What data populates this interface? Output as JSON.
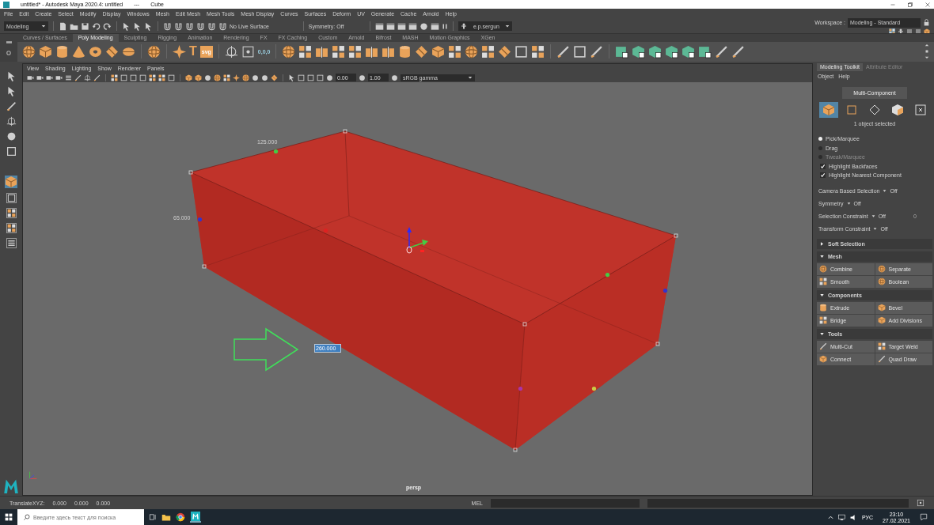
{
  "window": {
    "title": "untitled* - Autodesk Maya 2020.4: untitled",
    "separator": "---",
    "object": "Cube"
  },
  "menu_bar": [
    "File",
    "Edit",
    "Create",
    "Select",
    "Modify",
    "Display",
    "Windows",
    "Mesh",
    "Edit Mesh",
    "Mesh Tools",
    "Mesh Display",
    "Curves",
    "Surfaces",
    "Deform",
    "UV",
    "Generate",
    "Cache",
    "Arnold",
    "Help"
  ],
  "status_line": {
    "menu_set": "Modeling",
    "live_surface": "No Live Surface",
    "symmetry": "Symmetry: Off",
    "user": "e.p.sergun",
    "workspace_label": "Workspace :",
    "workspace": "Modeling - Standard"
  },
  "shelf": {
    "tabs": [
      {
        "label": "Curves / Surfaces",
        "selected": false
      },
      {
        "label": "Poly Modeling",
        "selected": true
      },
      {
        "label": "Sculpting",
        "selected": false
      },
      {
        "label": "Rigging",
        "selected": false
      },
      {
        "label": "Animation",
        "selected": false
      },
      {
        "label": "Rendering",
        "selected": false
      },
      {
        "label": "FX",
        "selected": false
      },
      {
        "label": "FX Caching",
        "selected": false
      },
      {
        "label": "Custom",
        "selected": false
      },
      {
        "label": "Arnold",
        "selected": false
      },
      {
        "label": "Bifrost",
        "selected": false
      },
      {
        "label": "MASH",
        "selected": false
      },
      {
        "label": "Motion Graphics",
        "selected": false
      },
      {
        "label": "XGen",
        "selected": false
      }
    ],
    "glyph_labels": [
      "T",
      "svg",
      "0,0,0"
    ]
  },
  "viewport": {
    "menus": [
      "View",
      "Shading",
      "Lighting",
      "Show",
      "Renderer",
      "Panels"
    ],
    "exposure": "0.00",
    "gamma": "1.00",
    "color_space": "sRGB gamma",
    "dimension_labels": [
      "125.000",
      "65.000"
    ],
    "length_input": "260.000",
    "camera": "persp"
  },
  "toolkit": {
    "tabs": [
      {
        "label": "Modeling Toolkit",
        "selected": true
      },
      {
        "label": "Attribute Editor",
        "selected": false
      }
    ],
    "menus": [
      "Object",
      "Help"
    ],
    "multi_component": "Multi-Component",
    "modes": [
      {
        "selected": true
      },
      {
        "selected": false
      },
      {
        "selected": false
      },
      {
        "selected": false
      },
      {
        "selected": false
      }
    ],
    "status": "1 object selected",
    "options": [
      {
        "kind": "radio",
        "label": "Pick/Marquee",
        "selected": true,
        "disabled": false
      },
      {
        "kind": "radio",
        "label": "Drag",
        "selected": false,
        "disabled": false
      },
      {
        "kind": "radio",
        "label": "Tweak/Marquee",
        "selected": false,
        "disabled": true
      },
      {
        "kind": "checkbox",
        "label": "Highlight Backfaces",
        "checked": true
      },
      {
        "kind": "checkbox",
        "label": "Highlight Nearest Component",
        "checked": true
      }
    ],
    "settings": [
      {
        "label": "Camera Based Selection",
        "value": "Off"
      },
      {
        "label": "Symmetry",
        "value": "Off"
      },
      {
        "label": "Selection Constraint",
        "value": "Off",
        "extra": "0"
      },
      {
        "label": "Transform Constraint",
        "value": "Off"
      }
    ],
    "sections": [
      {
        "title": "Soft Selection",
        "expanded": false
      },
      {
        "title": "Mesh",
        "expanded": true,
        "buttons": [
          "Combine",
          "Separate",
          "Smooth",
          "Boolean"
        ]
      },
      {
        "title": "Components",
        "expanded": true,
        "buttons": [
          "Extrude",
          "Bevel",
          "Bridge",
          "Add Divisions"
        ]
      },
      {
        "title": "Tools",
        "expanded": true,
        "buttons": [
          "Multi-Cut",
          "Target Weld",
          "Connect",
          "Quad Draw"
        ]
      }
    ]
  },
  "help_line": {
    "label": "TranslateXYZ:",
    "values": [
      "0.000",
      "0.000",
      "0.000"
    ],
    "command_language": "MEL"
  },
  "taskbar": {
    "search": {
      "placeholder": "Введите здесь текст для поиска"
    },
    "language": "РУС",
    "time": "23:10",
    "date": "27.02.2021"
  }
}
